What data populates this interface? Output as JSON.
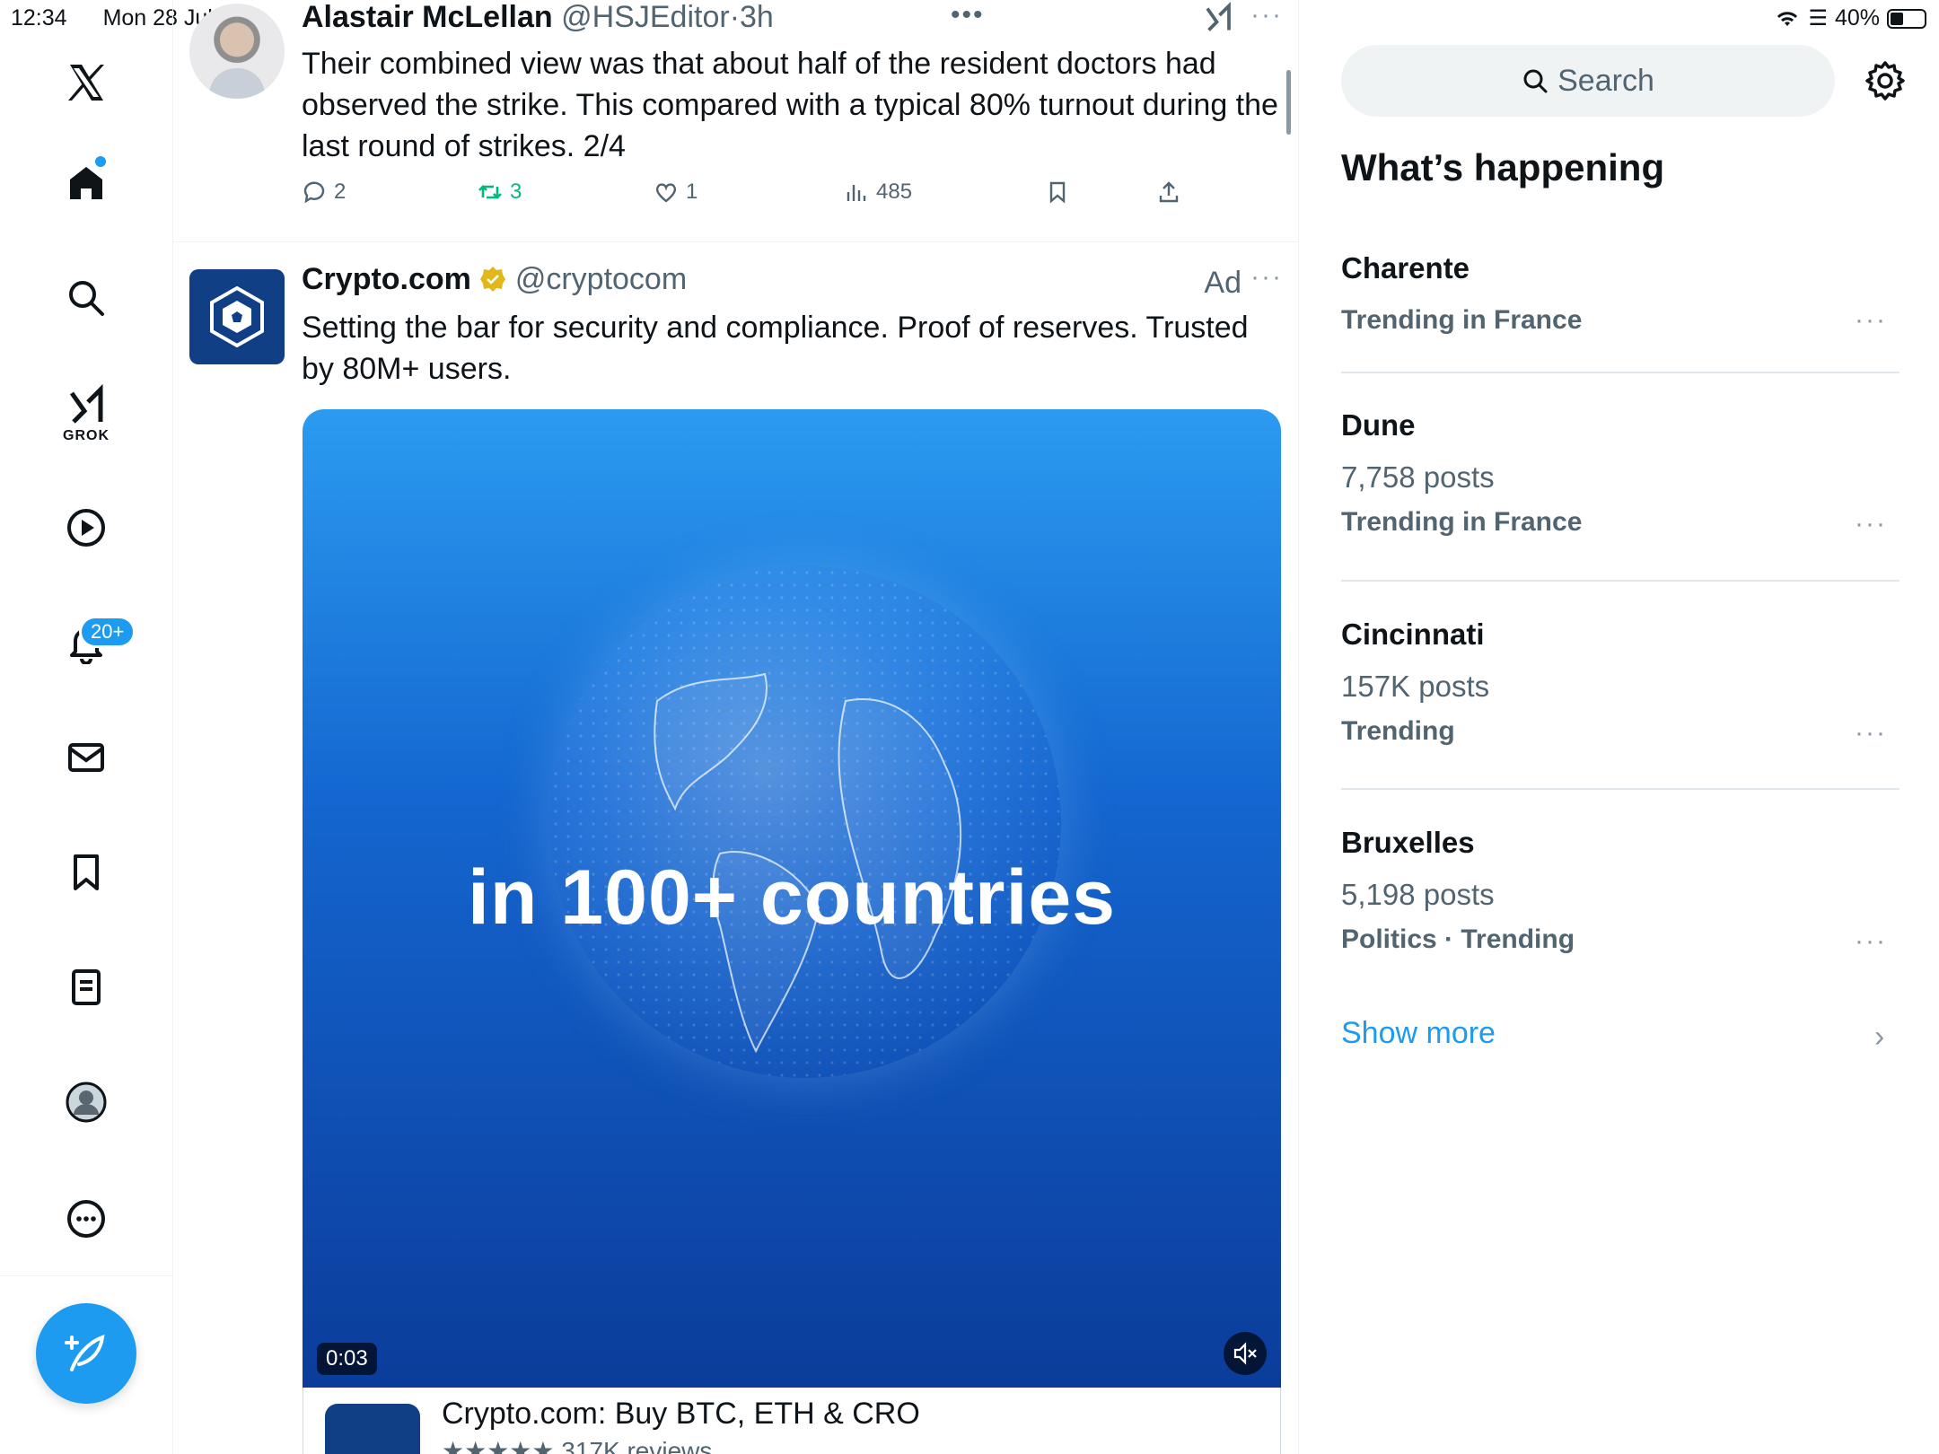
{
  "status_bar": {
    "time": "12:34",
    "date": "Mon 28 Jul",
    "battery": "40%",
    "battery_level": 0.4
  },
  "nav": {
    "items": [
      {
        "name": "x-logo-icon"
      },
      {
        "name": "home-icon"
      },
      {
        "name": "search-icon"
      },
      {
        "name": "grok-icon",
        "label": "GROK"
      },
      {
        "name": "play-video-icon"
      },
      {
        "name": "bell-icon",
        "badge": "20+"
      },
      {
        "name": "mail-icon"
      },
      {
        "name": "bookmark-icon"
      },
      {
        "name": "list-icon"
      },
      {
        "name": "profile-avatar-icon"
      },
      {
        "name": "more-icon"
      }
    ],
    "compose_icon": "compose-feather-icon",
    "accent": "#1d9bf0"
  },
  "tweet1": {
    "name": "Alastair McLellan",
    "handle": "@HSJEditor",
    "separator": "·",
    "time": "3h",
    "text": "Their combined view was that about half of the resident doctors had observed the strike. This compared with a typical 80% turnout during the last round of strikes. 2/4",
    "replies": "2",
    "retweets": "3",
    "likes": "1",
    "views": "485"
  },
  "tweet2": {
    "name": "Crypto.com",
    "handle": "@cryptocom",
    "ad_label": "Ad",
    "text": "Setting the bar for security and compliance. Proof of reserves. Trusted by 80M+ users.",
    "media_text": "in 100+ countries",
    "timer": "0:03",
    "card_title": "Crypto.com: Buy BTC, ETH & CRO",
    "card_rating": "★★★★★",
    "card_reviews": "317K reviews"
  },
  "right": {
    "search_placeholder": "Search",
    "section_title": "What’s happening",
    "trends": [
      {
        "name": "Charente",
        "count": "",
        "meta": "Trending in France"
      },
      {
        "name": "Dune",
        "count": "7,758 posts",
        "meta": "Trending in France"
      },
      {
        "name": "Cincinnati",
        "count": "157K posts",
        "meta": "Trending"
      },
      {
        "name": "Bruxelles",
        "count": "5,198 posts",
        "meta": "Politics · Trending"
      }
    ],
    "show_more": "Show more"
  }
}
